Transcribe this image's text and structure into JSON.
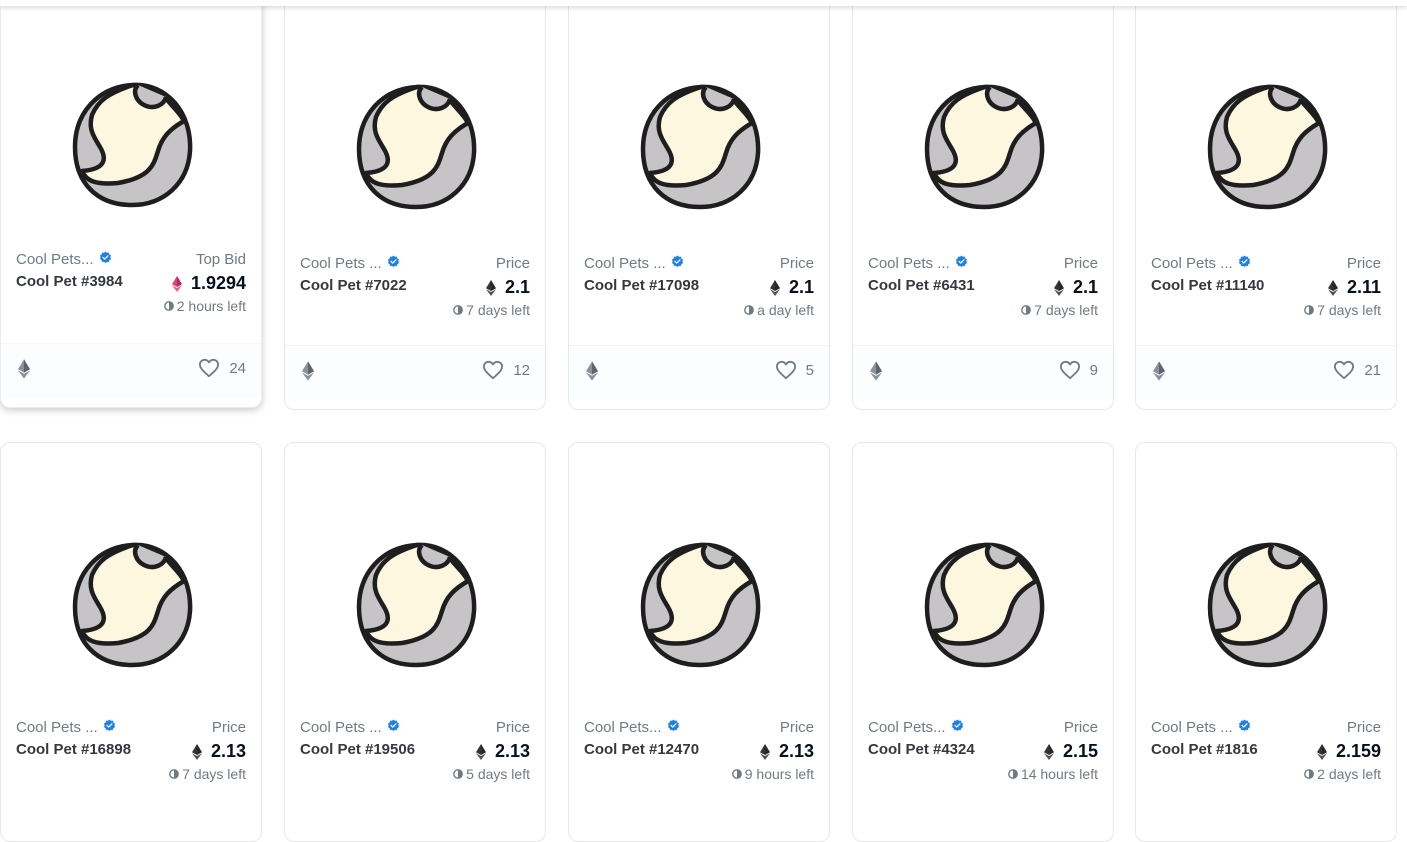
{
  "colors": {
    "pet_fill_light": "#fdf7e0",
    "pet_fill_gray": "#c6c4c6",
    "outline": "#1e1e1e",
    "verified": "#2081e2",
    "eth_pink": "#e73e7b",
    "eth_dark": "#343434"
  },
  "cards": [
    {
      "collection": "Cool Pets...",
      "name": "Cool Pet #3984",
      "price_label": "Top Bid",
      "price": "1.9294",
      "price_icon": "weth-icon",
      "time_left": "2 hours left",
      "likes": "24"
    },
    {
      "collection": "Cool Pets ...",
      "name": "Cool Pet #7022",
      "price_label": "Price",
      "price": "2.1",
      "price_icon": "eth-icon",
      "time_left": "7 days left",
      "likes": "12"
    },
    {
      "collection": "Cool Pets ...",
      "name": "Cool Pet #17098",
      "price_label": "Price",
      "price": "2.1",
      "price_icon": "eth-icon",
      "time_left": "a day left",
      "likes": "5"
    },
    {
      "collection": "Cool Pets ...",
      "name": "Cool Pet #6431",
      "price_label": "Price",
      "price": "2.1",
      "price_icon": "eth-icon",
      "time_left": "7 days left",
      "likes": "9"
    },
    {
      "collection": "Cool Pets ...",
      "name": "Cool Pet #11140",
      "price_label": "Price",
      "price": "2.11",
      "price_icon": "eth-icon",
      "time_left": "7 days left",
      "likes": "21"
    },
    {
      "collection": "Cool Pets ...",
      "name": "Cool Pet #16898",
      "price_label": "Price",
      "price": "2.13",
      "price_icon": "eth-icon",
      "time_left": "7 days left",
      "likes": ""
    },
    {
      "collection": "Cool Pets ...",
      "name": "Cool Pet #19506",
      "price_label": "Price",
      "price": "2.13",
      "price_icon": "eth-icon",
      "time_left": "5 days left",
      "likes": ""
    },
    {
      "collection": "Cool Pets...",
      "name": "Cool Pet #12470",
      "price_label": "Price",
      "price": "2.13",
      "price_icon": "eth-icon",
      "time_left": "9 hours left",
      "likes": ""
    },
    {
      "collection": "Cool Pets...",
      "name": "Cool Pet #4324",
      "price_label": "Price",
      "price": "2.15",
      "price_icon": "eth-icon",
      "time_left": "14 hours left",
      "likes": ""
    },
    {
      "collection": "Cool Pets ...",
      "name": "Cool Pet #1816",
      "price_label": "Price",
      "price": "2.159",
      "price_icon": "eth-icon",
      "time_left": "2 days left",
      "likes": ""
    }
  ]
}
